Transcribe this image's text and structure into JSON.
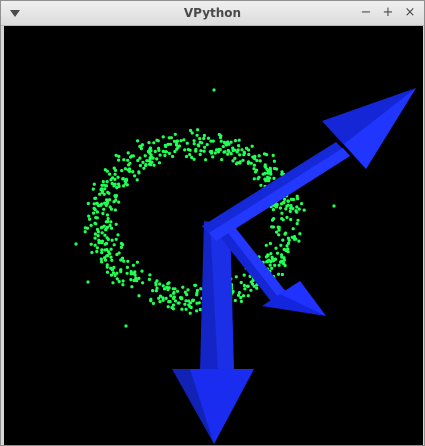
{
  "window": {
    "title": "VPython",
    "menu_icon": "chevron-down-icon",
    "minimize_label": "−",
    "maximize_label": "+",
    "close_label": "×"
  },
  "scene": {
    "background": "#000000",
    "particle_color": "#22ff55",
    "arrow_color": "#1a2bff"
  }
}
